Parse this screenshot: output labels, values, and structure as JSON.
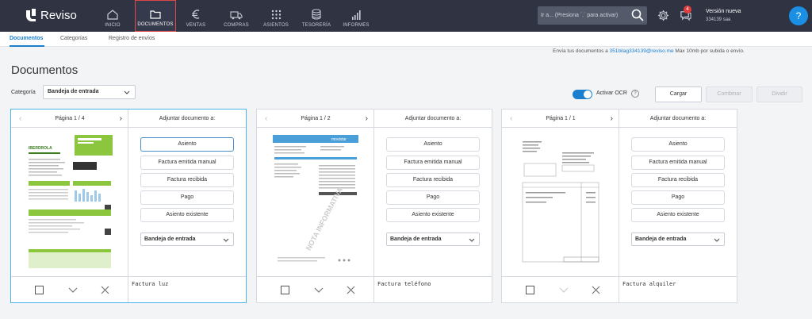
{
  "app": {
    "name": "Reviso"
  },
  "nav": [
    {
      "id": "inicio",
      "label": "INICIO",
      "icon": "home-icon"
    },
    {
      "id": "documentos",
      "label": "DOCUMENTOS",
      "icon": "folder-icon",
      "active": true
    },
    {
      "id": "ventas",
      "label": "VENTAS",
      "icon": "euro-icon"
    },
    {
      "id": "compras",
      "label": "COMPRAS",
      "icon": "truck-icon"
    },
    {
      "id": "asientos",
      "label": "ASIENTOS",
      "icon": "grid-icon"
    },
    {
      "id": "tesoreria",
      "label": "TESORERÍA",
      "icon": "coins-icon"
    },
    {
      "id": "informes",
      "label": "INFORMES",
      "icon": "bar-chart-icon"
    }
  ],
  "search": {
    "placeholder": "Ir a... (Presiona ´.´ para activar)"
  },
  "notifications": {
    "count": "4"
  },
  "version": {
    "title": "Versión nueva",
    "account": "334139 saa"
  },
  "help": {
    "label": "?"
  },
  "subtabs": [
    "Documentos",
    "Categorías",
    "Registro de envíos"
  ],
  "page": {
    "title": "Documentos",
    "send_info_prefix": "Envía tus documentos a ",
    "send_info_email": "351bilag334139@reviso.me",
    "send_info_suffix": " Max 10mb por subida o envío."
  },
  "category": {
    "label": "Categoría",
    "value": "Bandeja de entrada"
  },
  "ocr": {
    "label": "Activar OCR",
    "enabled": true,
    "help": "?"
  },
  "buttons": {
    "cargar": "Cargar",
    "combinar": "Combinar",
    "dividir": "Dividir"
  },
  "attach_title": "Adjuntar documento a:",
  "attach_options": [
    "Asiento",
    "Factura emitida manual",
    "Factura recibida",
    "Pago",
    "Asiento existente"
  ],
  "cards": [
    {
      "pager": "Página 1 / 4",
      "destination": "Bandeja de entrada",
      "note": "Factura luz",
      "brand": "IBERDROLA"
    },
    {
      "pager": "Página 1 / 2",
      "destination": "Bandeja de entrada",
      "note": "Factura teléfono",
      "brand": "movistar",
      "stamp": "NOTA INFORMATIVA"
    },
    {
      "pager": "Página 1 / 1",
      "destination": "Bandeja de entrada",
      "note": "Factura alquiler"
    }
  ],
  "colors": {
    "topbar": "#2f3342",
    "accent": "#1a7fcf",
    "active_border": "#e04747",
    "badge": "#e23b3b"
  }
}
